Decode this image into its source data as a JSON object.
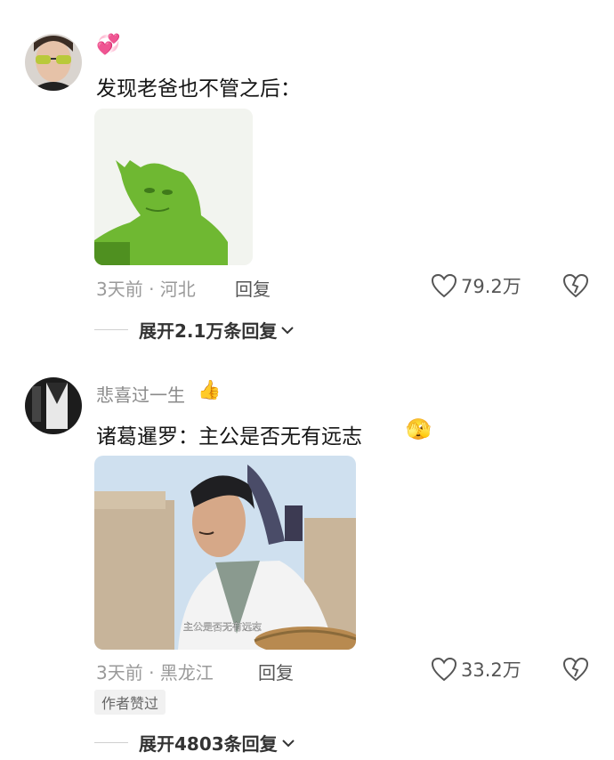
{
  "comments": [
    {
      "username": "",
      "username_emoji": "💞",
      "text": "发现老爸也不管之后：",
      "time_location": "3天前 · 河北",
      "reply_label": "回复",
      "likes": "79.2万",
      "expand_label": "展开2.1万条回复"
    },
    {
      "username": "悲喜过一生",
      "username_emoji": "👍",
      "text": "诸葛暹罗：主公是否无有远志",
      "text_emoji": "🫣",
      "time_location": "3天前 · 黑龙江",
      "reply_label": "回复",
      "likes": "33.2万",
      "author_badge": "作者赞过",
      "expand_label": "展开4803条回复",
      "image_subtitle": "主公是否无有远志"
    }
  ],
  "colors": {
    "meta_gray": "#9a9a9a",
    "green_figure": "#7cc23a",
    "sky": "#cfe0ef"
  }
}
